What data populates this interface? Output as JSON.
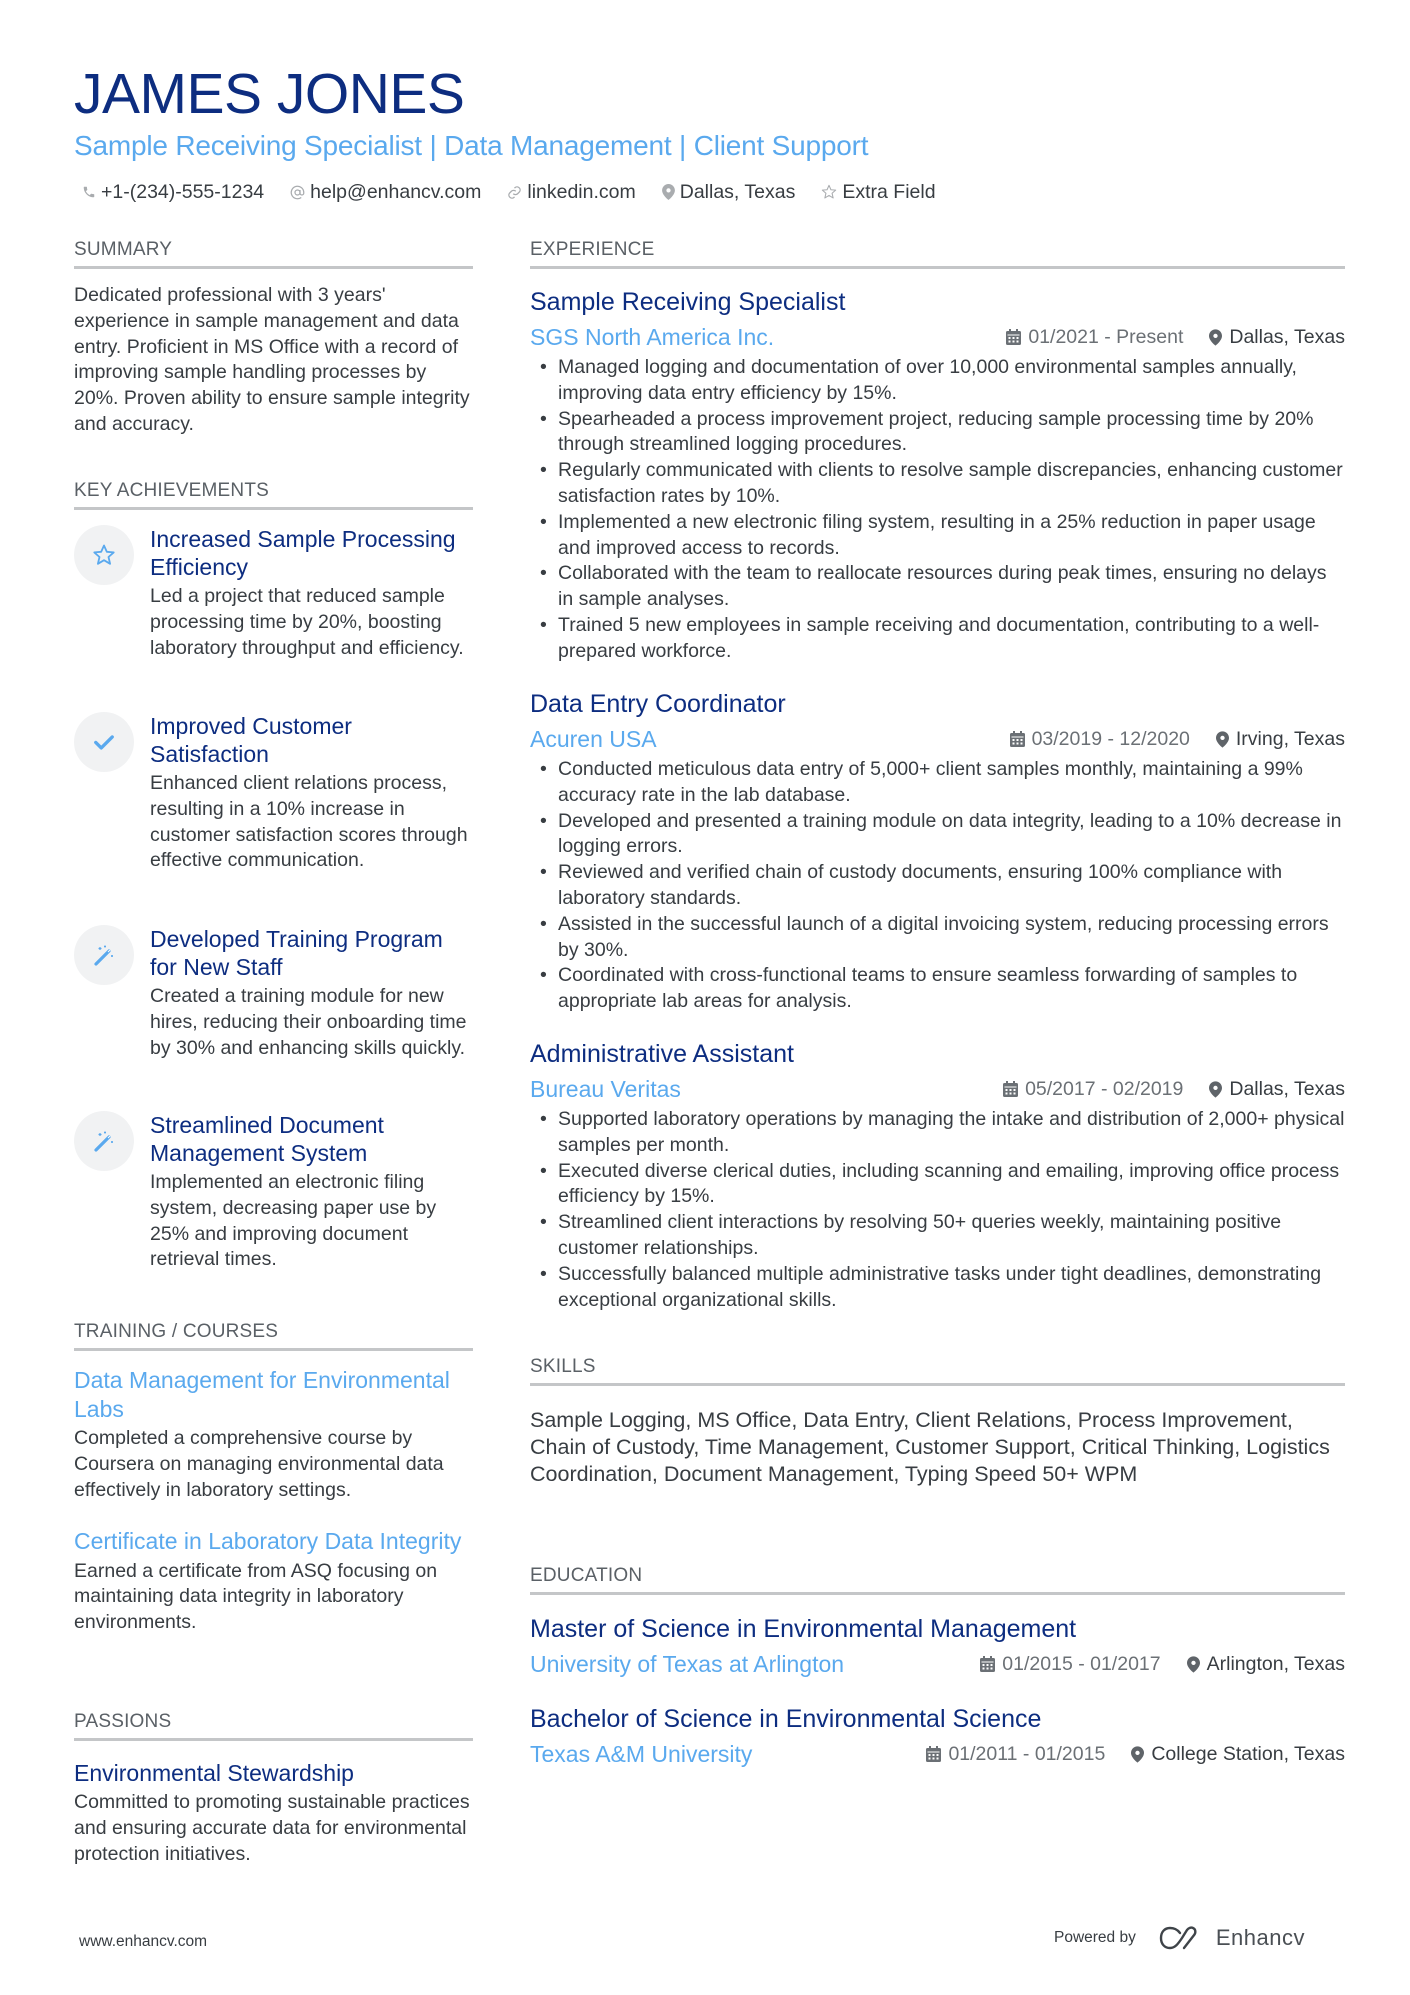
{
  "header": {
    "name": "JAMES JONES",
    "title": "Sample Receiving Specialist | Data Management | Client Support",
    "contacts": [
      {
        "icon": "phone-icon",
        "text": "+1-(234)-555-1234"
      },
      {
        "icon": "at-icon",
        "text": "help@enhancv.com"
      },
      {
        "icon": "link-icon",
        "text": "linkedin.com"
      },
      {
        "icon": "location-pin-icon",
        "text": "Dallas, Texas"
      },
      {
        "icon": "star-icon",
        "text": "Extra Field"
      }
    ]
  },
  "summary": {
    "heading": "SUMMARY",
    "text": "Dedicated professional with 3 years' experience in sample management and data entry. Proficient in MS Office with a record of improving sample handling processes by 20%. Proven ability to ensure sample integrity and accuracy."
  },
  "achievements": {
    "heading": "KEY ACHIEVEMENTS",
    "items": [
      {
        "icon": "star-icon",
        "title": "Increased Sample Processing Efficiency",
        "description": "Led a project that reduced sample processing time by 20%, boosting laboratory throughput and efficiency."
      },
      {
        "icon": "checkmark-icon",
        "title": "Improved Customer Satisfaction",
        "description": "Enhanced client relations process, resulting in a 10% increase in customer satisfaction scores through effective communication."
      },
      {
        "icon": "magic-wand-icon",
        "title": "Developed Training Program for New Staff",
        "description": "Created a training module for new hires, reducing their onboarding time by 30% and enhancing skills quickly."
      },
      {
        "icon": "magic-wand-icon",
        "title": "Streamlined Document Management System",
        "description": "Implemented an electronic filing system, decreasing paper use by 25% and improving document retrieval times."
      }
    ]
  },
  "training": {
    "heading": "TRAINING / COURSES",
    "items": [
      {
        "title": "Data Management for Environmental Labs",
        "description": "Completed a comprehensive course by Coursera on managing environmental data effectively in laboratory settings."
      },
      {
        "title": "Certificate in Laboratory Data Integrity",
        "description": "Earned a certificate from ASQ focusing on maintaining data integrity in laboratory environments."
      }
    ]
  },
  "passions": {
    "heading": "PASSIONS",
    "items": [
      {
        "title": "Environmental Stewardship",
        "description": "Committed to promoting sustainable practices and ensuring accurate data for environmental protection initiatives."
      }
    ]
  },
  "experience": {
    "heading": "EXPERIENCE",
    "jobs": [
      {
        "title": "Sample Receiving Specialist",
        "company": "SGS North America Inc.",
        "dates": "01/2021 - Present",
        "location": "Dallas, Texas",
        "bullets": [
          "Managed logging and documentation of over 10,000 environmental samples annually, improving data entry efficiency by 15%.",
          "Spearheaded a process improvement project, reducing sample processing time by 20% through streamlined logging procedures.",
          "Regularly communicated with clients to resolve sample discrepancies, enhancing customer satisfaction rates by 10%.",
          "Implemented a new electronic filing system, resulting in a 25% reduction in paper usage and improved access to records.",
          "Collaborated with the team to reallocate resources during peak times, ensuring no delays in sample analyses.",
          "Trained 5 new employees in sample receiving and documentation, contributing to a well-prepared workforce."
        ]
      },
      {
        "title": "Data Entry Coordinator",
        "company": "Acuren USA",
        "dates": "03/2019 - 12/2020",
        "location": "Irving, Texas",
        "bullets": [
          "Conducted meticulous data entry of 5,000+ client samples monthly, maintaining a 99% accuracy rate in the lab database.",
          "Developed and presented a training module on data integrity, leading to a 10% decrease in logging errors.",
          "Reviewed and verified chain of custody documents, ensuring 100% compliance with laboratory standards.",
          "Assisted in the successful launch of a digital invoicing system, reducing processing errors by 30%.",
          "Coordinated with cross-functional teams to ensure seamless forwarding of samples to appropriate lab areas for analysis."
        ]
      },
      {
        "title": "Administrative Assistant",
        "company": "Bureau Veritas",
        "dates": "05/2017 - 02/2019",
        "location": "Dallas, Texas",
        "bullets": [
          "Supported laboratory operations by managing the intake and distribution of 2,000+ physical samples per month.",
          "Executed diverse clerical duties, including scanning and emailing, improving office process efficiency by 15%.",
          "Streamlined client interactions by resolving 50+ queries weekly, maintaining positive customer relationships.",
          "Successfully balanced multiple administrative tasks under tight deadlines, demonstrating exceptional organizational skills."
        ]
      }
    ]
  },
  "skills": {
    "heading": "SKILLS",
    "text": "Sample Logging, MS Office, Data Entry, Client Relations, Process Improvement, Chain of Custody, Time Management, Customer Support, Critical Thinking, Logistics Coordination, Document Management, Typing Speed 50+ WPM"
  },
  "education": {
    "heading": "EDUCATION",
    "items": [
      {
        "degree": "Master of Science in Environmental Management",
        "institution": "University of Texas at Arlington",
        "dates": "01/2015 - 01/2017",
        "location": "Arlington, Texas"
      },
      {
        "degree": "Bachelor of Science in Environmental Science",
        "institution": "Texas A&M University",
        "dates": "01/2011 - 01/2015",
        "location": "College Station, Texas"
      }
    ]
  },
  "footer": {
    "website": "www.enhancv.com",
    "powered_by": "Powered by",
    "brand": "Enhancv"
  },
  "colors": {
    "name": "#0d2d80",
    "accent": "#5aa9ee",
    "text": "#383d42",
    "muted": "#6b7075",
    "rule": "#c4c6c8",
    "icon_bg": "#f1f2f3"
  }
}
